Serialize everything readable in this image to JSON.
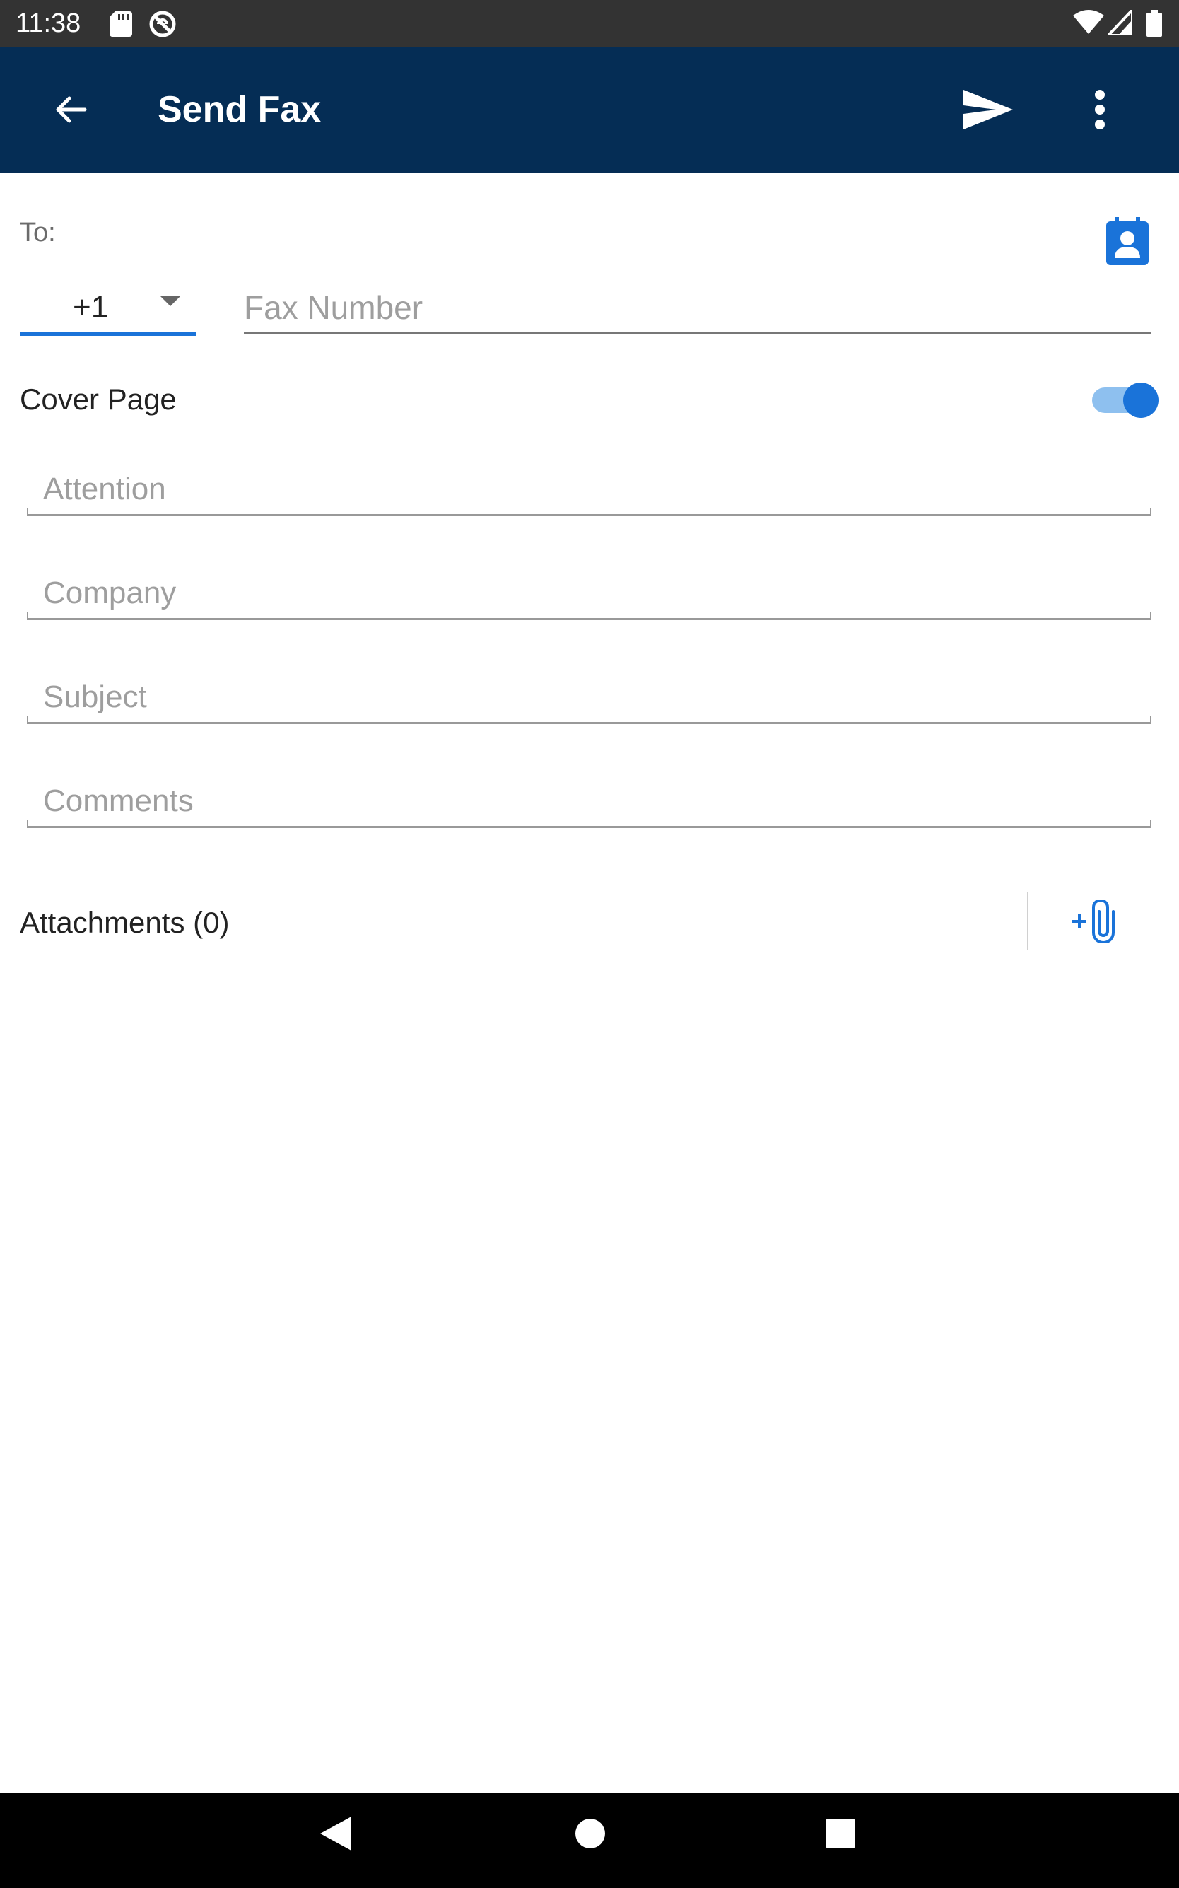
{
  "status_bar": {
    "time": "11:38",
    "icons": [
      "sd-card-icon",
      "sync-disabled-icon",
      "wifi-icon",
      "signal-icon",
      "battery-icon"
    ]
  },
  "app_bar": {
    "title": "Send Fax",
    "back_icon": "arrow-left-icon",
    "send_icon": "send-icon",
    "more_icon": "more-vert-icon",
    "background": "#052d55"
  },
  "recipient": {
    "to_label": "To:",
    "contacts_icon": "contact-book-icon",
    "country_code": "+1",
    "fax_number_placeholder": "Fax Number",
    "fax_number_value": ""
  },
  "cover_page": {
    "label": "Cover Page",
    "enabled": true,
    "fields": [
      {
        "placeholder": "Attention",
        "value": ""
      },
      {
        "placeholder": "Company",
        "value": ""
      },
      {
        "placeholder": "Subject",
        "value": ""
      },
      {
        "placeholder": "Comments",
        "value": ""
      }
    ]
  },
  "attachments": {
    "label": "Attachments (0)",
    "add_icon": "add-attachment-icon"
  },
  "nav_bar": {
    "icons": [
      "back-triangle-icon",
      "home-circle-icon",
      "recents-square-icon"
    ]
  },
  "colors": {
    "accent": "#1a73d9",
    "toggle_track": "#8ec0ef",
    "status_bar": "#333333"
  }
}
